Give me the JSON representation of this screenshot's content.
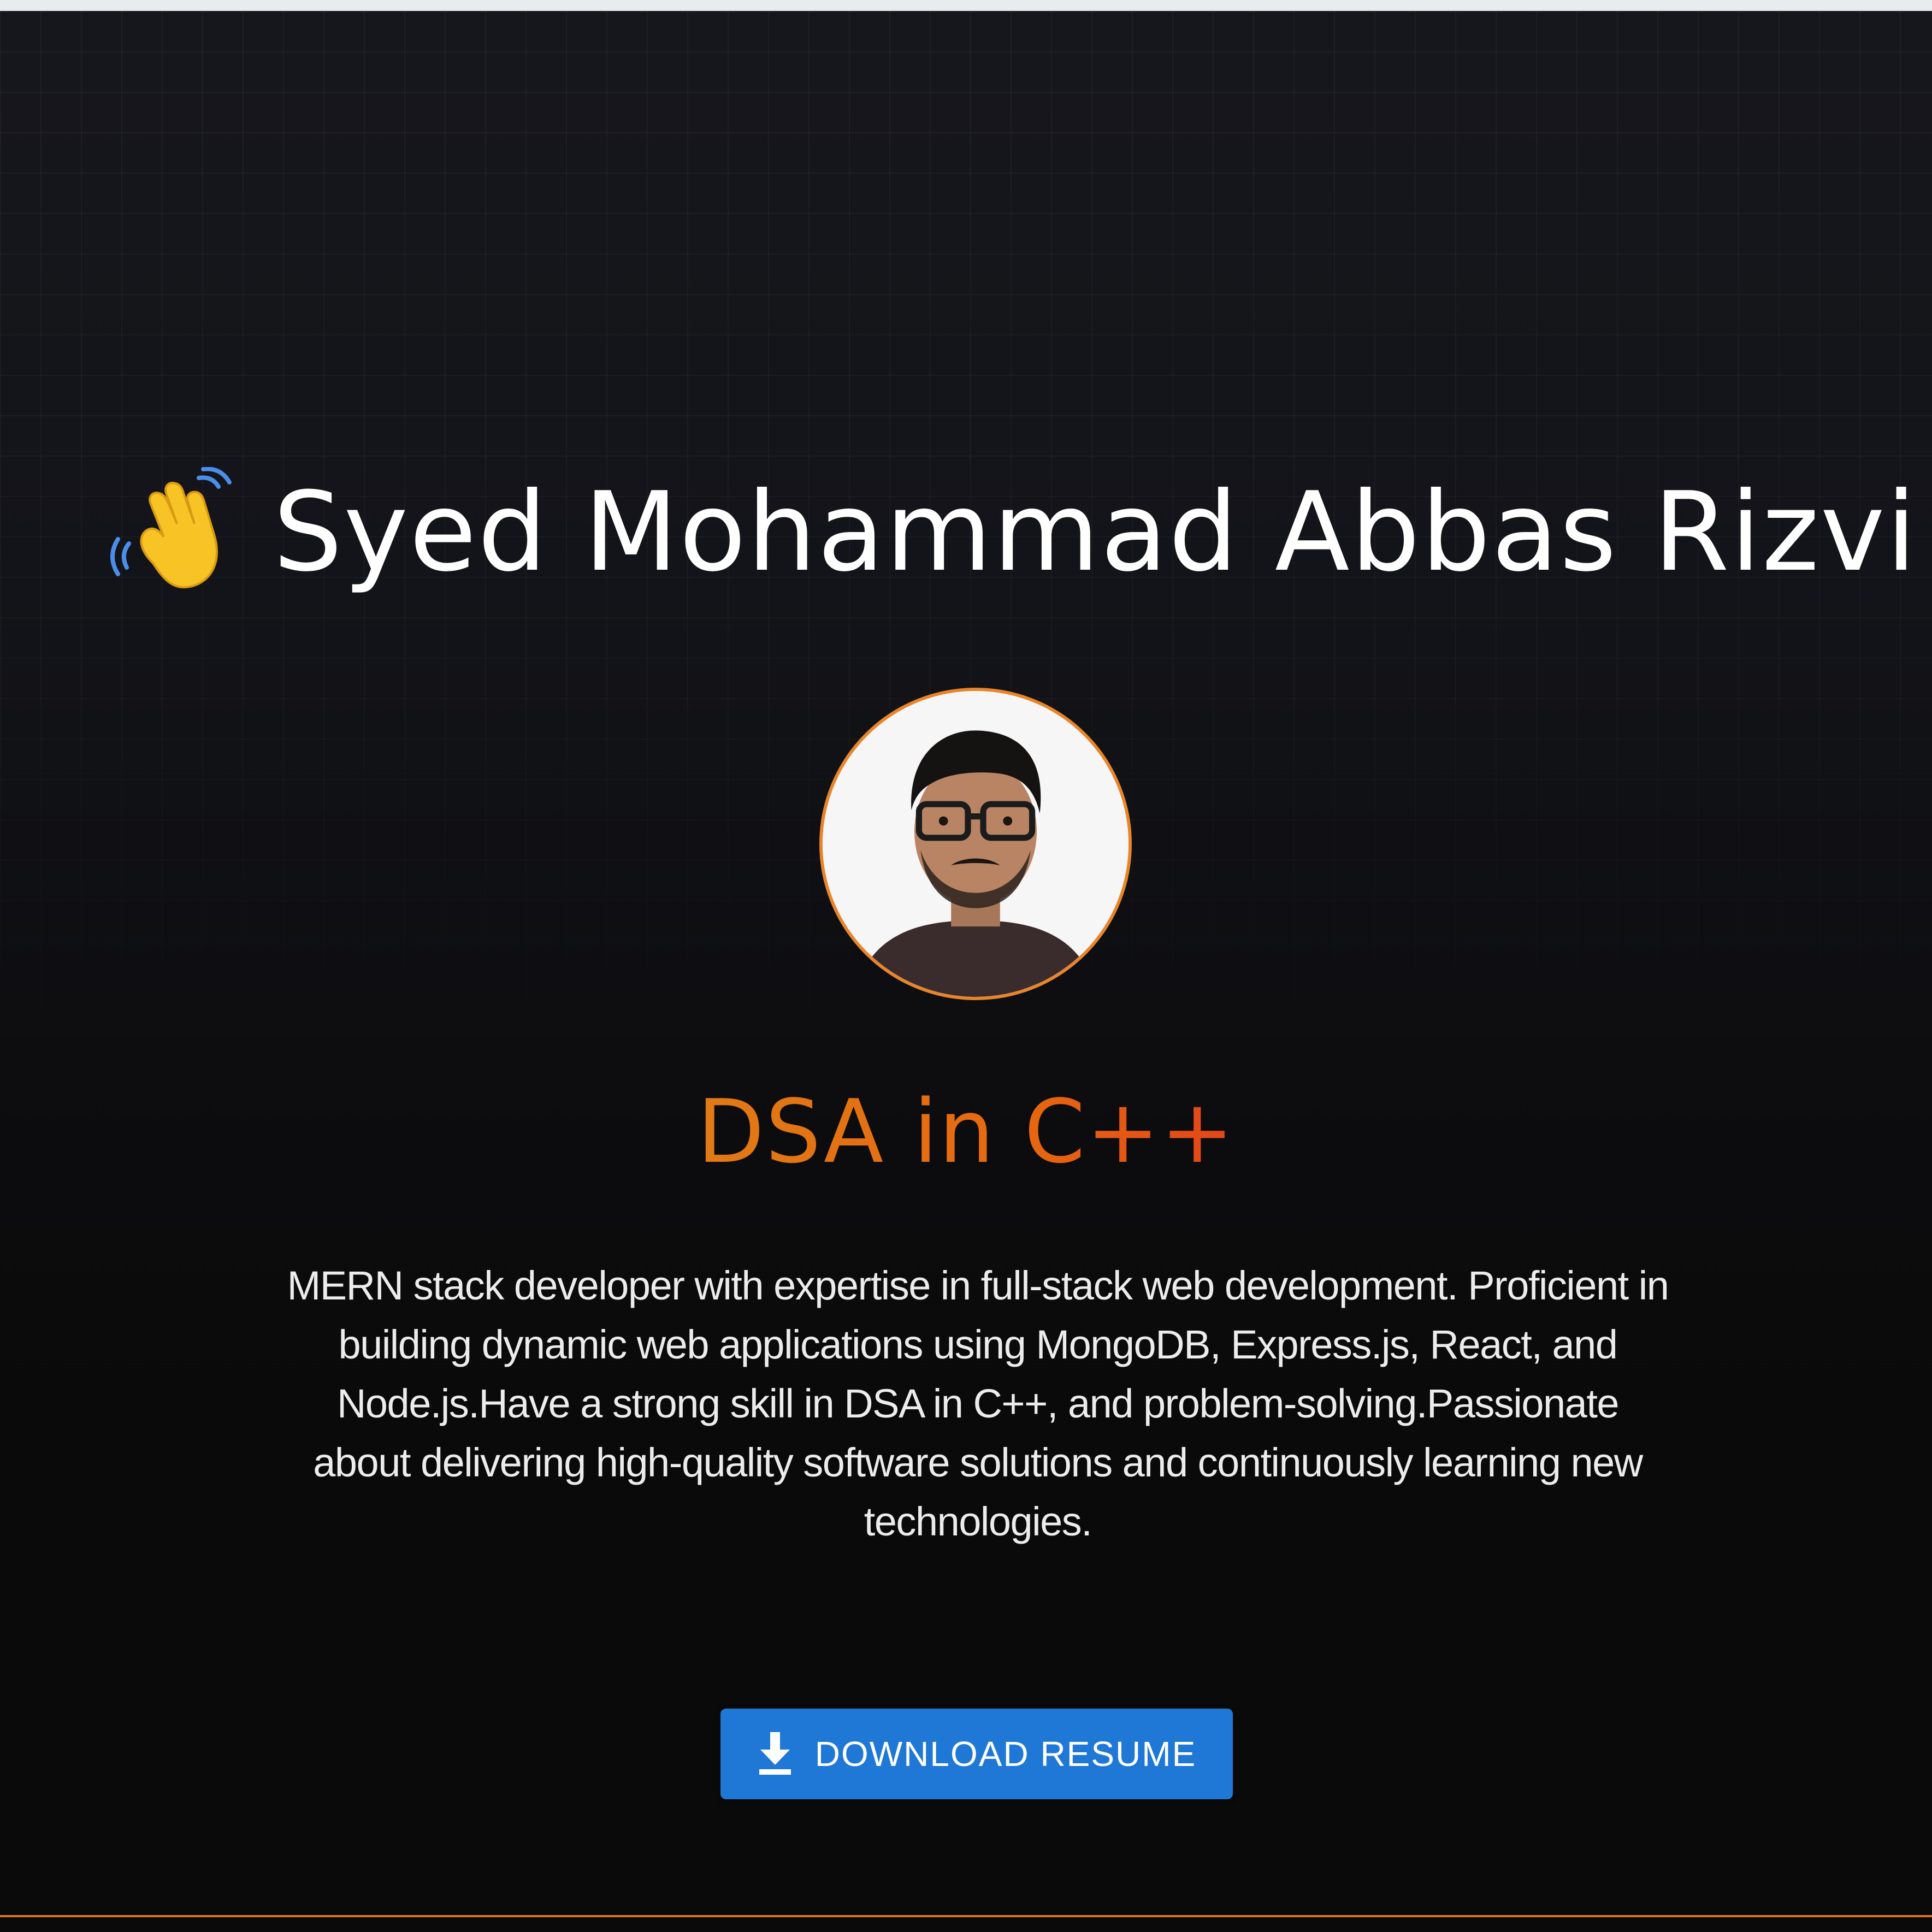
{
  "hero": {
    "name": "Syed Mohammad Abbas Rizvi",
    "wave_icon": "waving-hand-icon"
  },
  "profile": {
    "avatar_icon": "profile-photo",
    "ring_color": "#e8852a"
  },
  "subtitle": {
    "text": "DSA in C++",
    "gradient_colors": [
      "#e07a16",
      "#e6680f",
      "#e2461a"
    ]
  },
  "bio": {
    "text": "MERN stack developer with expertise in full-stack web development. Proficient in building dynamic web applications using MongoDB, Express.js, React, and Node.js.Have a strong skill in DSA in C++, and problem-solving.Passionate about delivering high-quality software solutions and continuously learning new technologies."
  },
  "actions": {
    "download_label": "DOWNLOAD RESUME",
    "download_icon": "download-icon",
    "button_color": "#1f78d6"
  },
  "theme": {
    "background": "#0a0a0a",
    "accent": "#e0761a"
  }
}
